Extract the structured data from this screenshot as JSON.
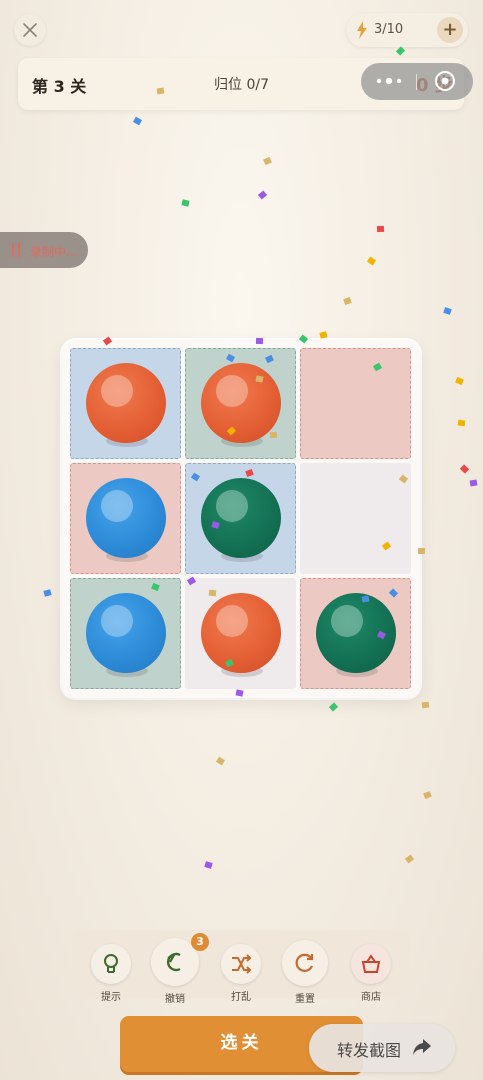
{
  "top": {
    "close_icon": "close-icon",
    "energy_icon": "lightning-icon",
    "energy_value": "3/10",
    "energy_plus": "+"
  },
  "header": {
    "level": "第 3 关",
    "home_progress": "归位 0/7",
    "score": "0 步"
  },
  "capsule": {
    "more_icon": "more-dots-icon",
    "close_icon": "target-close-icon"
  },
  "recording": {
    "label": "录制中..."
  },
  "board": {
    "rows": 3,
    "cols": 3,
    "cells": [
      [
        "blue-slot",
        "green-slot",
        "red-slot"
      ],
      [
        "red-slot",
        "blue-slot",
        "empty"
      ],
      [
        "green-slot",
        "empty",
        "red-slot"
      ]
    ],
    "balls": [
      [
        "red",
        "red",
        null
      ],
      [
        "blue",
        "green",
        null
      ],
      [
        "blue",
        "red",
        "green"
      ]
    ]
  },
  "toolbar": {
    "items": [
      {
        "label": "提示",
        "icon": "lightbulb-icon"
      },
      {
        "label": "撤销",
        "icon": "undo-icon"
      },
      {
        "label": "打乱",
        "icon": "shuffle-icon"
      },
      {
        "label": "重置",
        "icon": "reset-icon"
      },
      {
        "label": "商店",
        "icon": "shop-basket-icon"
      }
    ],
    "undo_badge": "3"
  },
  "select_button": "选关",
  "share_button": "转发截图",
  "colors": {
    "red_ball": "#e45f34",
    "blue_ball": "#2d8bd8",
    "green_ball": "#147154",
    "accent": "#e18f35"
  }
}
